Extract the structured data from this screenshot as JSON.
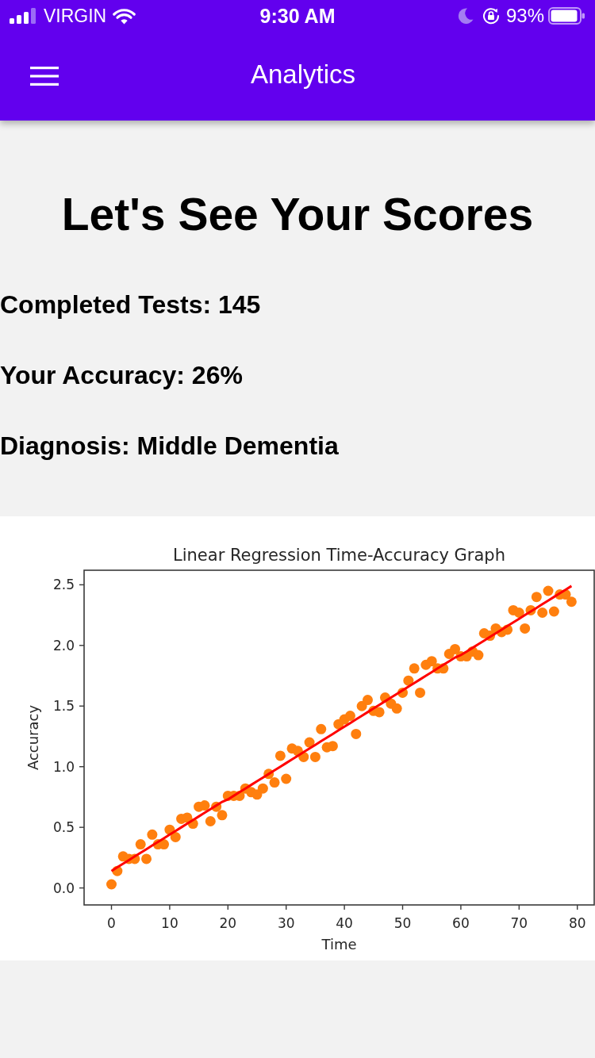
{
  "status_bar": {
    "carrier": "VIRGIN",
    "time": "9:30 AM",
    "battery": "93%"
  },
  "app_bar": {
    "title": "Analytics"
  },
  "heading": "Let's See Your Scores",
  "stats": [
    "Completed Tests: 145",
    "Your Accuracy: 26%",
    "Diagnosis: Middle Dementia"
  ],
  "chart": {
    "chart_data": {
      "type": "scatter",
      "title": "Linear Regression Time-Accuracy Graph",
      "xlabel": "Time",
      "ylabel": "Accuracy",
      "x": [
        0,
        1,
        2,
        3,
        4,
        5,
        6,
        7,
        8,
        9,
        10,
        11,
        12,
        13,
        14,
        15,
        16,
        17,
        18,
        19,
        20,
        21,
        22,
        23,
        24,
        25,
        26,
        27,
        28,
        29,
        30,
        31,
        32,
        33,
        34,
        35,
        36,
        37,
        38,
        39,
        40,
        41,
        42,
        43,
        44,
        45,
        46,
        47,
        48,
        49,
        50,
        51,
        52,
        53,
        54,
        55,
        56,
        57,
        58,
        59,
        60,
        61,
        62,
        63,
        64,
        65,
        66,
        67,
        68,
        69,
        70,
        71,
        72,
        73,
        74,
        75,
        76,
        77,
        78,
        79
      ],
      "series": [
        {
          "type": "scatter",
          "color": "#ff7f0e",
          "values": [
            0.03,
            0.14,
            0.26,
            0.24,
            0.24,
            0.36,
            0.24,
            0.44,
            0.36,
            0.36,
            0.48,
            0.42,
            0.57,
            0.58,
            0.53,
            0.67,
            0.68,
            0.55,
            0.67,
            0.6,
            0.76,
            0.76,
            0.76,
            0.82,
            0.79,
            0.77,
            0.82,
            0.94,
            0.87,
            1.09,
            0.9,
            1.15,
            1.13,
            1.08,
            1.2,
            1.08,
            1.31,
            1.16,
            1.17,
            1.35,
            1.39,
            1.42,
            1.27,
            1.5,
            1.55,
            1.46,
            1.45,
            1.57,
            1.52,
            1.48,
            1.61,
            1.71,
            1.81,
            1.61,
            1.84,
            1.87,
            1.81,
            1.81,
            1.93,
            1.97,
            1.91,
            1.91,
            1.95,
            1.92,
            2.1,
            2.08,
            2.14,
            2.11,
            2.13,
            2.29,
            2.27,
            2.14,
            2.29,
            2.4,
            2.27,
            2.45,
            2.28,
            2.42,
            2.42,
            2.36
          ]
        },
        {
          "type": "line",
          "color": "#ff0000",
          "values": [
            0.14,
            0.17,
            0.2,
            0.23,
            0.26,
            0.29,
            0.32,
            0.35,
            0.38,
            0.41,
            0.44,
            0.47,
            0.5,
            0.53,
            0.56,
            0.59,
            0.62,
            0.65,
            0.68,
            0.71,
            0.73,
            0.76,
            0.79,
            0.82,
            0.85,
            0.88,
            0.91,
            0.94,
            0.97,
            1.0,
            1.03,
            1.06,
            1.09,
            1.12,
            1.15,
            1.18,
            1.21,
            1.24,
            1.27,
            1.3,
            1.33,
            1.36,
            1.39,
            1.42,
            1.45,
            1.48,
            1.51,
            1.54,
            1.57,
            1.6,
            1.63,
            1.66,
            1.69,
            1.72,
            1.75,
            1.78,
            1.81,
            1.84,
            1.87,
            1.9,
            1.92,
            1.95,
            1.98,
            2.01,
            2.04,
            2.07,
            2.1,
            2.13,
            2.16,
            2.19,
            2.22,
            2.25,
            2.28,
            2.31,
            2.34,
            2.37,
            2.4,
            2.43,
            2.46,
            2.49
          ]
        }
      ],
      "xlim": [
        -4.7,
        82.9
      ],
      "ylim": [
        -0.14,
        2.62
      ],
      "xticks": [
        0,
        10,
        20,
        30,
        40,
        50,
        60,
        70,
        80
      ],
      "yticks": [
        {
          "value": 0,
          "label": "0.0"
        },
        {
          "value": 0.5,
          "label": "0.5"
        },
        {
          "value": 1,
          "label": "1.0"
        },
        {
          "value": 1.5,
          "label": "1.5"
        },
        {
          "value": 2,
          "label": "2.0"
        },
        {
          "value": 2.5,
          "label": "2.5"
        }
      ]
    }
  }
}
